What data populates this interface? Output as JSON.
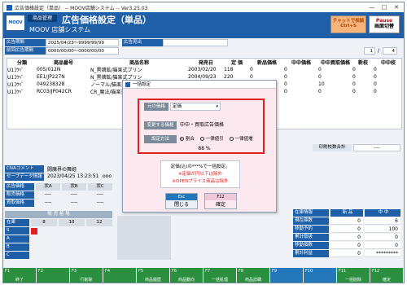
{
  "window": {
    "title": "広告価格設定（単品） -- MOOV店舗システム -- Ver3.25.03",
    "min": "—",
    "max": "□",
    "close": "✕"
  },
  "header": {
    "badge": "商品管理",
    "title": "広告価格設定（単品）",
    "logo": "MOOV",
    "system_name": "MOOV 店舗システム",
    "chat_button": "チャットで相談",
    "chat_sub": "Ctrl+S",
    "pause_button": "Pause",
    "pause_sub": "画面切替"
  },
  "fields": {
    "period_label": "広告期間",
    "period_value": "2025/04/23～9999/99/99",
    "ad_out_label": "広告見出",
    "prev_period_label": "前回広告期間",
    "prev_period_value": "0000/00/00～0000/00/00",
    "page_current": "1",
    "page_sep": "/",
    "page_total": "4"
  },
  "grid": {
    "headers": [
      "分類",
      "商品番号",
      "商品名称",
      "発売日",
      "定 価",
      "新品価格",
      "中中価格",
      "中中買取価格",
      "新校",
      "中中校"
    ],
    "rows": [
      [
        "U1ｺｳﾍﾞ",
        "005/012N",
        "N_黒燐鉱/猫楽式プリン",
        "2003/02/20",
        "118",
        "0",
        "0",
        "0",
        "0",
        "0"
      ],
      [
        "U1ｺｳﾍﾞ",
        "EE1/JP227N",
        "N_黒燐鉱/猫楽式プリン",
        "2004/09/23",
        "220",
        "0",
        "0",
        "0",
        "0",
        "0"
      ],
      [
        "U1ｺｳﾍﾞ",
        "049238328",
        "ノーマル/猫楽式で全え",
        "",
        "",
        "0",
        "0",
        "10",
        "0",
        "0"
      ],
      [
        "U1ｺｳﾍﾞ",
        "RC03/JP042CR",
        "CR_魔法/猫楽式プリン",
        "",
        "",
        "0",
        "0",
        "0",
        "0",
        "0"
      ]
    ]
  },
  "lower": {
    "comment_label": "CNAコメント",
    "comment_value": "闘魔界の舞姫",
    "update_label": "セーブデータ情報",
    "update_value": "2023/04/25 13:23:51",
    "update_extra": "ooo",
    "price_info": [
      "広告価格",
      "状A",
      "状B",
      "状C"
    ],
    "sale_price": "販売価格",
    "buy_price": "買取価格",
    "dashes": "----",
    "stock_block_title": "販 売 格 場",
    "rank_header": [
      "在庫",
      "8",
      "10",
      "12"
    ],
    "ranks": [
      "S",
      "A",
      "B",
      "C"
    ],
    "inventory_label": "印刷校数合計",
    "inventory_value": "----",
    "right_head": [
      "在庫情報",
      "新 品",
      "中 中"
    ],
    "right_rows": [
      [
        "現在庫数",
        "0",
        "6"
      ],
      [
        "移動予約",
        "0",
        "100"
      ],
      [
        "累計取扱",
        "0",
        "0"
      ],
      [
        "移動個数",
        "0",
        "0"
      ],
      [
        "累計利益",
        "0",
        "*********"
      ]
    ]
  },
  "dialog": {
    "title": "一括設定",
    "from_label": "元の価格",
    "from_value": "定価",
    "change_label": "変更する価格",
    "change_value": "中中・買取広告価格",
    "method_label": "設定方法",
    "method_options": [
      "割合",
      "一律値引",
      "一律値増"
    ],
    "percent": "88 %",
    "note_line1": "定価(込)の***%で一括設定。",
    "note_line2": "※定価が円以下は除外",
    "note_line3": "※OPENプライス商品は除外",
    "close_key": "Esc",
    "close_label": "閉じる",
    "ok_key": "F12",
    "ok_label": "確定"
  },
  "fkeys": [
    {
      "k": "F1",
      "l": "終了"
    },
    {
      "k": "F2",
      "l": ""
    },
    {
      "k": "F3",
      "l": "行削除"
    },
    {
      "k": "F4",
      "l": ""
    },
    {
      "k": "F5",
      "l": "商品履歴"
    },
    {
      "k": "F6",
      "l": "商品動向"
    },
    {
      "k": "F7",
      "l": "一括処理"
    },
    {
      "k": "F8",
      "l": "商品詳細"
    },
    {
      "k": "F9",
      "l": ""
    },
    {
      "k": "F10",
      "l": ""
    },
    {
      "k": "F11",
      "l": "一括削除"
    },
    {
      "k": "F12",
      "l": "確定"
    }
  ],
  "colors": {
    "brand_blue": "#1f5fa8",
    "fkey_green": "#2a8f3e",
    "highlight_cyan": "#15a8d8",
    "alert_red": "#e02020"
  }
}
